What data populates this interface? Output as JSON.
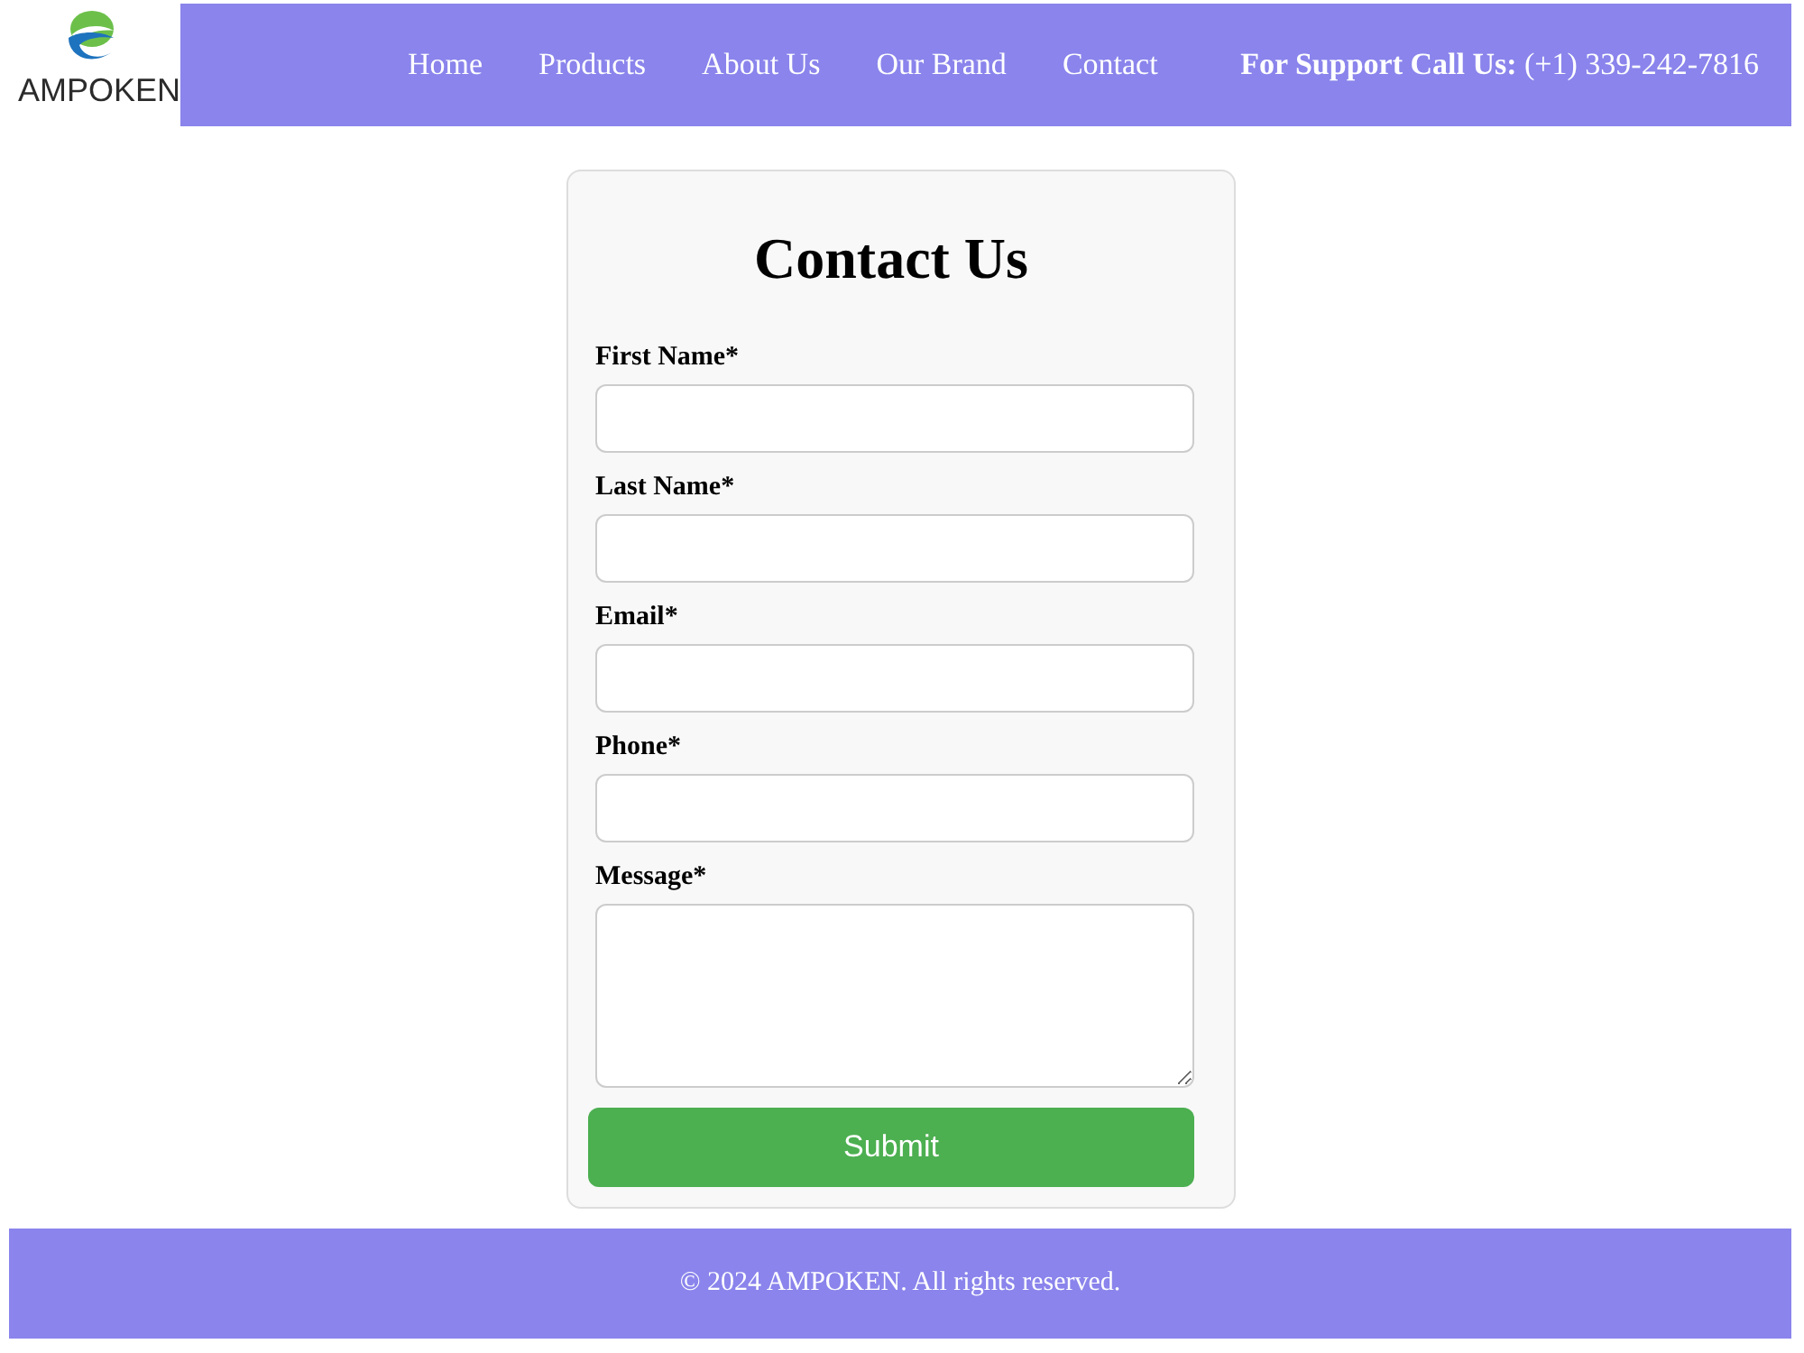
{
  "logo": {
    "text": "AMPOKEN"
  },
  "nav": {
    "links": [
      {
        "label": "Home"
      },
      {
        "label": "Products"
      },
      {
        "label": "About Us"
      },
      {
        "label": "Our Brand"
      },
      {
        "label": "Contact"
      }
    ],
    "support": "**For Support Call Us:** (+1) 339-242-7816"
  },
  "form": {
    "title": "Contact Us",
    "fields": [
      {
        "label": "First Name*",
        "kind": "input"
      },
      {
        "label": "Last Name*",
        "kind": "input"
      },
      {
        "label": "Email*",
        "kind": "input"
      },
      {
        "label": "Phone*",
        "kind": "input"
      },
      {
        "label": "Message*",
        "kind": "textarea"
      }
    ],
    "submit": "Submit"
  },
  "footer": {
    "text": "© 2024 AMPOKEN. All rights reserved."
  }
}
